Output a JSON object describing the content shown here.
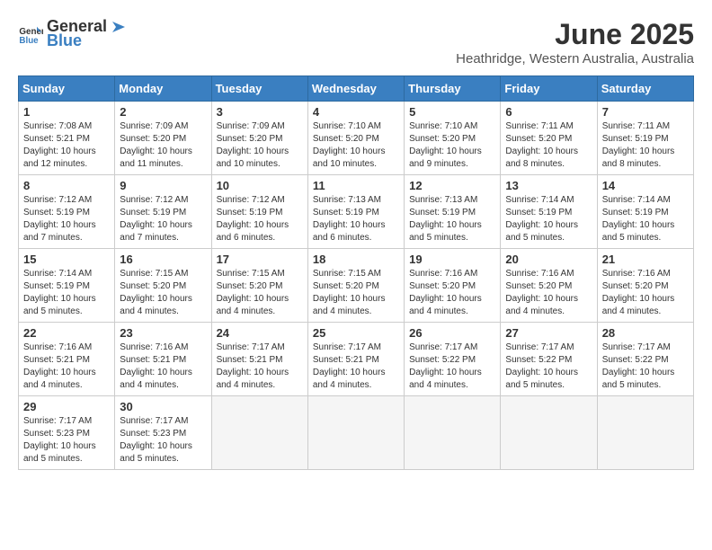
{
  "logo": {
    "general": "General",
    "blue": "Blue"
  },
  "title": "June 2025",
  "location": "Heathridge, Western Australia, Australia",
  "weekdays": [
    "Sunday",
    "Monday",
    "Tuesday",
    "Wednesday",
    "Thursday",
    "Friday",
    "Saturday"
  ],
  "weeks": [
    [
      {
        "day": 1,
        "sunrise": "7:08 AM",
        "sunset": "5:21 PM",
        "daylight": "10 hours and 12 minutes."
      },
      {
        "day": 2,
        "sunrise": "7:09 AM",
        "sunset": "5:20 PM",
        "daylight": "10 hours and 11 minutes."
      },
      {
        "day": 3,
        "sunrise": "7:09 AM",
        "sunset": "5:20 PM",
        "daylight": "10 hours and 10 minutes."
      },
      {
        "day": 4,
        "sunrise": "7:10 AM",
        "sunset": "5:20 PM",
        "daylight": "10 hours and 10 minutes."
      },
      {
        "day": 5,
        "sunrise": "7:10 AM",
        "sunset": "5:20 PM",
        "daylight": "10 hours and 9 minutes."
      },
      {
        "day": 6,
        "sunrise": "7:11 AM",
        "sunset": "5:20 PM",
        "daylight": "10 hours and 8 minutes."
      },
      {
        "day": 7,
        "sunrise": "7:11 AM",
        "sunset": "5:19 PM",
        "daylight": "10 hours and 8 minutes."
      }
    ],
    [
      {
        "day": 8,
        "sunrise": "7:12 AM",
        "sunset": "5:19 PM",
        "daylight": "10 hours and 7 minutes."
      },
      {
        "day": 9,
        "sunrise": "7:12 AM",
        "sunset": "5:19 PM",
        "daylight": "10 hours and 7 minutes."
      },
      {
        "day": 10,
        "sunrise": "7:12 AM",
        "sunset": "5:19 PM",
        "daylight": "10 hours and 6 minutes."
      },
      {
        "day": 11,
        "sunrise": "7:13 AM",
        "sunset": "5:19 PM",
        "daylight": "10 hours and 6 minutes."
      },
      {
        "day": 12,
        "sunrise": "7:13 AM",
        "sunset": "5:19 PM",
        "daylight": "10 hours and 5 minutes."
      },
      {
        "day": 13,
        "sunrise": "7:14 AM",
        "sunset": "5:19 PM",
        "daylight": "10 hours and 5 minutes."
      },
      {
        "day": 14,
        "sunrise": "7:14 AM",
        "sunset": "5:19 PM",
        "daylight": "10 hours and 5 minutes."
      }
    ],
    [
      {
        "day": 15,
        "sunrise": "7:14 AM",
        "sunset": "5:19 PM",
        "daylight": "10 hours and 5 minutes."
      },
      {
        "day": 16,
        "sunrise": "7:15 AM",
        "sunset": "5:20 PM",
        "daylight": "10 hours and 4 minutes."
      },
      {
        "day": 17,
        "sunrise": "7:15 AM",
        "sunset": "5:20 PM",
        "daylight": "10 hours and 4 minutes."
      },
      {
        "day": 18,
        "sunrise": "7:15 AM",
        "sunset": "5:20 PM",
        "daylight": "10 hours and 4 minutes."
      },
      {
        "day": 19,
        "sunrise": "7:16 AM",
        "sunset": "5:20 PM",
        "daylight": "10 hours and 4 minutes."
      },
      {
        "day": 20,
        "sunrise": "7:16 AM",
        "sunset": "5:20 PM",
        "daylight": "10 hours and 4 minutes."
      },
      {
        "day": 21,
        "sunrise": "7:16 AM",
        "sunset": "5:20 PM",
        "daylight": "10 hours and 4 minutes."
      }
    ],
    [
      {
        "day": 22,
        "sunrise": "7:16 AM",
        "sunset": "5:21 PM",
        "daylight": "10 hours and 4 minutes."
      },
      {
        "day": 23,
        "sunrise": "7:16 AM",
        "sunset": "5:21 PM",
        "daylight": "10 hours and 4 minutes."
      },
      {
        "day": 24,
        "sunrise": "7:17 AM",
        "sunset": "5:21 PM",
        "daylight": "10 hours and 4 minutes."
      },
      {
        "day": 25,
        "sunrise": "7:17 AM",
        "sunset": "5:21 PM",
        "daylight": "10 hours and 4 minutes."
      },
      {
        "day": 26,
        "sunrise": "7:17 AM",
        "sunset": "5:22 PM",
        "daylight": "10 hours and 4 minutes."
      },
      {
        "day": 27,
        "sunrise": "7:17 AM",
        "sunset": "5:22 PM",
        "daylight": "10 hours and 5 minutes."
      },
      {
        "day": 28,
        "sunrise": "7:17 AM",
        "sunset": "5:22 PM",
        "daylight": "10 hours and 5 minutes."
      }
    ],
    [
      {
        "day": 29,
        "sunrise": "7:17 AM",
        "sunset": "5:23 PM",
        "daylight": "10 hours and 5 minutes."
      },
      {
        "day": 30,
        "sunrise": "7:17 AM",
        "sunset": "5:23 PM",
        "daylight": "10 hours and 5 minutes."
      },
      null,
      null,
      null,
      null,
      null
    ]
  ],
  "labels": {
    "sunrise": "Sunrise:",
    "sunset": "Sunset:",
    "daylight": "Daylight:"
  }
}
